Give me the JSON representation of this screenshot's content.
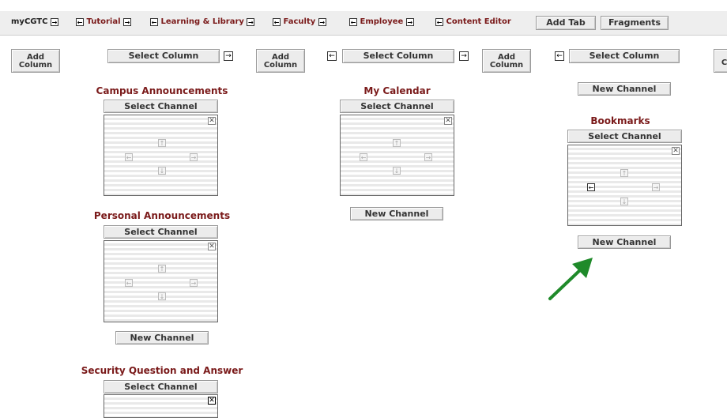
{
  "tabs": [
    {
      "label": "myCGTC"
    },
    {
      "label": "Tutorial"
    },
    {
      "label": "Learning & Library"
    },
    {
      "label": "Faculty"
    },
    {
      "label": "Employee"
    },
    {
      "label": "Content Editor"
    }
  ],
  "tabbar": {
    "add_tab": "Add Tab",
    "fragments": "Fragments"
  },
  "columns": {
    "add_column": "Add Column",
    "select_column": "Select Column"
  },
  "channels": {
    "select_channel": "Select Channel",
    "new_channel": "New Channel",
    "campus": "Campus Announcements",
    "personal": "Personal Announcements",
    "security": "Security Question and Answer",
    "calendar": "My Calendar",
    "bookmarks": "Bookmarks"
  },
  "icons": {
    "arrow_right": "→",
    "arrow_left": "←",
    "arrow_up": "↑",
    "arrow_down": "↓",
    "close": "✕"
  },
  "colors": {
    "channel_title": "#7a1a1a",
    "annotation_arrow": "#1f8a2a"
  }
}
